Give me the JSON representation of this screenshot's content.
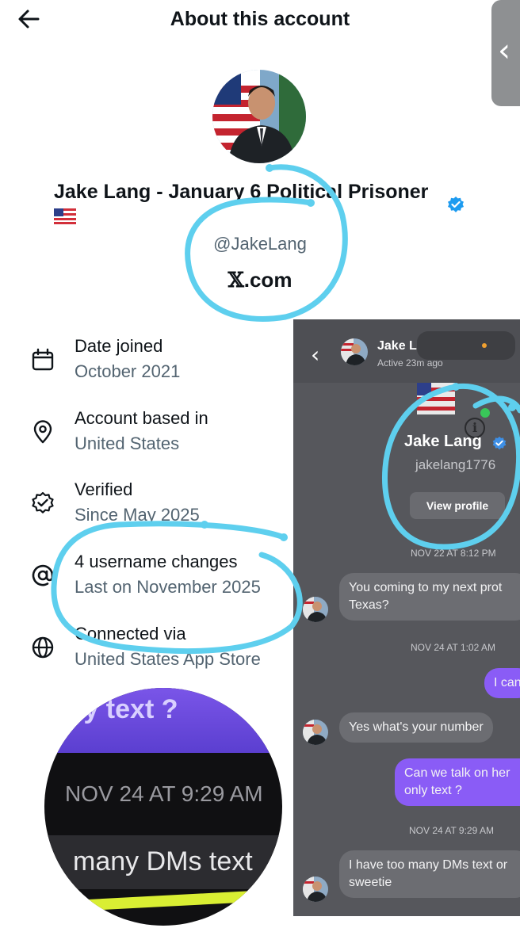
{
  "header": {
    "title": "About this account",
    "back_icon": "arrow-left-icon"
  },
  "profile": {
    "display_name": "Jake Lang - January 6 Political Prisoner",
    "flag": "us-flag-emoji",
    "handle": "@JakeLang",
    "domain_suffix": ".com",
    "verified_color": "#1d9bf0"
  },
  "info": {
    "items": [
      {
        "icon": "calendar-icon",
        "label": "Date joined",
        "value": "October 2021"
      },
      {
        "icon": "location-pin-icon",
        "label": "Account based in",
        "value": "United States"
      },
      {
        "icon": "verified-badge-icon",
        "label": "Verified",
        "value": "Since May 2025"
      },
      {
        "icon": "at-sign-icon",
        "label": "4 username changes",
        "value": "Last on November 2025"
      },
      {
        "icon": "globe-icon",
        "label": "Connected via",
        "value": "United States App Store"
      }
    ]
  },
  "dm": {
    "header_name": "Jake L",
    "active_status": "Active 23m ago",
    "profile_name": "Jake Lang",
    "profile_handle": "jakelang1776",
    "view_profile_label": "View profile",
    "timestamps": [
      "NOV 22 AT 8:12 PM",
      "NOV 24 AT 1:02 AM",
      "NOV 24 AT 9:29 AM"
    ],
    "messages": [
      {
        "direction": "in",
        "lines": [
          "You coming to my next prot",
          "Texas?"
        ]
      },
      {
        "direction": "out",
        "lines": [
          "I can"
        ]
      },
      {
        "direction": "in",
        "lines": [
          "Yes what's your number"
        ]
      },
      {
        "direction": "out",
        "lines": [
          "Can we talk on her",
          "only text ?"
        ]
      },
      {
        "direction": "in",
        "lines": [
          "I have too many DMs text or",
          "sweetie"
        ]
      }
    ]
  },
  "zoom": {
    "top_text": "ly text ?",
    "timestamp": "NOV 24 AT 9:29 AM",
    "bottom_text": "many DMs text"
  },
  "colors": {
    "annotation": "#5ecfee",
    "muted_text": "#536471",
    "dm_outgoing": "#8a5cf6"
  }
}
